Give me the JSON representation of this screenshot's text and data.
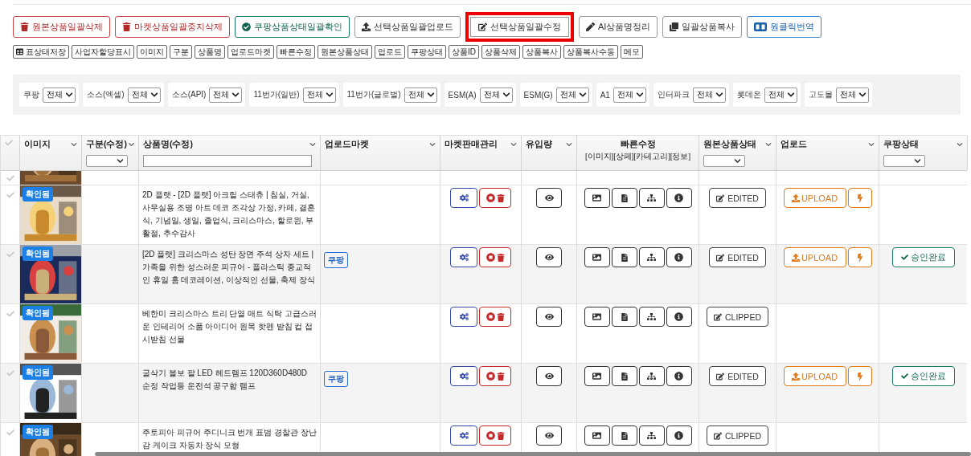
{
  "toolbar": [
    {
      "label": "원본상품일괄삭제",
      "kind": "danger",
      "highlighted": false
    },
    {
      "label": "마켓상품일괄중지삭제",
      "kind": "danger",
      "highlighted": false
    },
    {
      "label": "쿠팡상품상태일괄확인",
      "kind": "success",
      "highlighted": false
    },
    {
      "label": "선택상품일괄업로드",
      "kind": "default",
      "highlighted": false
    },
    {
      "label": "선택상품일괄수정",
      "kind": "default",
      "highlighted": true
    },
    {
      "label": "AI상품명정리",
      "kind": "default",
      "highlighted": false
    },
    {
      "label": "일괄상품복사",
      "kind": "default",
      "highlighted": false
    },
    {
      "label": "원클릭번역",
      "kind": "info",
      "highlighted": false
    }
  ],
  "column_toggles": [
    {
      "label": "표상태저장",
      "kind": "save"
    },
    {
      "label": "사업자할당표시",
      "kind": "toggle"
    },
    {
      "label": "이미지",
      "kind": "toggle"
    },
    {
      "label": "구분",
      "kind": "toggle"
    },
    {
      "label": "상품명",
      "kind": "toggle"
    },
    {
      "label": "업로드마켓",
      "kind": "toggle"
    },
    {
      "label": "빠른수정",
      "kind": "toggle"
    },
    {
      "label": "원본상품상태",
      "kind": "toggle"
    },
    {
      "label": "업로드",
      "kind": "toggle"
    },
    {
      "label": "쿠팡상태",
      "kind": "toggle"
    },
    {
      "label": "상품ID",
      "kind": "toggle"
    },
    {
      "label": "상품삭제",
      "kind": "toggle"
    },
    {
      "label": "상품복사",
      "kind": "toggle"
    },
    {
      "label": "상품복사수동",
      "kind": "toggle"
    },
    {
      "label": "메모",
      "kind": "toggle"
    }
  ],
  "filters": [
    {
      "label": "쿠팡",
      "value": "전체"
    },
    {
      "label": "소스(엑셀)",
      "value": "전체"
    },
    {
      "label": "소스(API)",
      "value": "전체"
    },
    {
      "label": "11번가(일반)",
      "value": "전체"
    },
    {
      "label": "11번가(글로벌)",
      "value": "전체"
    },
    {
      "label": "ESM(A)",
      "value": "전체"
    },
    {
      "label": "ESM(G)",
      "value": "전체"
    },
    {
      "label": "A1",
      "value": "전체"
    },
    {
      "label": "인터파크",
      "value": "전체"
    },
    {
      "label": "롯데온",
      "value": "전체"
    },
    {
      "label": "고도몰",
      "value": "전체"
    }
  ],
  "table": {
    "columns": [
      {
        "label": "이미지",
        "kind": "plain"
      },
      {
        "label": "구분(수정)",
        "kind": "select"
      },
      {
        "label": "상품명(수정)",
        "kind": "text"
      },
      {
        "label": "업로드마켓",
        "kind": "plain"
      },
      {
        "label": "마켓판매관리",
        "kind": "plain"
      },
      {
        "label": "유입량",
        "kind": "plain"
      },
      {
        "label": "빠른수정",
        "sublabel": "[이미지][상페][카테고리][정보]",
        "kind": "centered"
      },
      {
        "label": "원본상품상태",
        "kind": "select"
      },
      {
        "label": "업로드",
        "kind": "plain"
      },
      {
        "label": "쿠팡상태",
        "kind": "select"
      }
    ],
    "rows": [
      {
        "kind": "partial",
        "selected": false
      },
      {
        "kind": "full",
        "selected": false,
        "badge": "확인됨",
        "name": "2D 플랫 - [2D 플랫] 아크릴 스태츄 | 침실, 거실, 사무실용 조명 아트 데코 조각상 가정, 카페, 결혼식, 기념일, 생일, 졸업식, 크리스마스, 할로윈, 부활절, 추수감사",
        "market": "",
        "status": "EDITED",
        "upload": "UPLOAD",
        "coupang": ""
      },
      {
        "kind": "full",
        "selected": false,
        "badge": "확인됨",
        "name": "[2D 플랫] 크리스마스 성탄 장면 주석 상자 세트 | 가족을 위한 성스러운 피규어 - 플라스틱 종교적인 휴일 홈 데코레이션, 이상적인 선물, 축제 장식",
        "market": "쿠팡",
        "status": "EDITED",
        "upload": "UPLOAD",
        "coupang": "승인완료"
      },
      {
        "kind": "full",
        "selected": false,
        "badge": "확인됨",
        "name": "베한미 크리스마스 트리 단열 매트 식탁 고급스러운 인테리어 소품 아이디어 원목 핫펜 받침 컵 접시받침 선물",
        "market": "",
        "status": "CLIPPED",
        "upload": "",
        "coupang": ""
      },
      {
        "kind": "full",
        "selected": false,
        "badge": "확인됨",
        "name": "굴삭기 볼보 팔 LED 헤드램프 120D360D480D 순정 작업등 운전석 공구함 램프",
        "market": "쿠팡",
        "status": "EDITED",
        "upload": "UPLOAD",
        "coupang": "승인완료"
      },
      {
        "kind": "full",
        "selected": false,
        "badge": "확인됨",
        "name": "주토피아 피규어 주디니크 번개 표범 경찰관 장난감 케이크 자동차 장식 모형",
        "market": "",
        "status": "CLIPPED",
        "upload": "",
        "coupang": ""
      }
    ]
  }
}
